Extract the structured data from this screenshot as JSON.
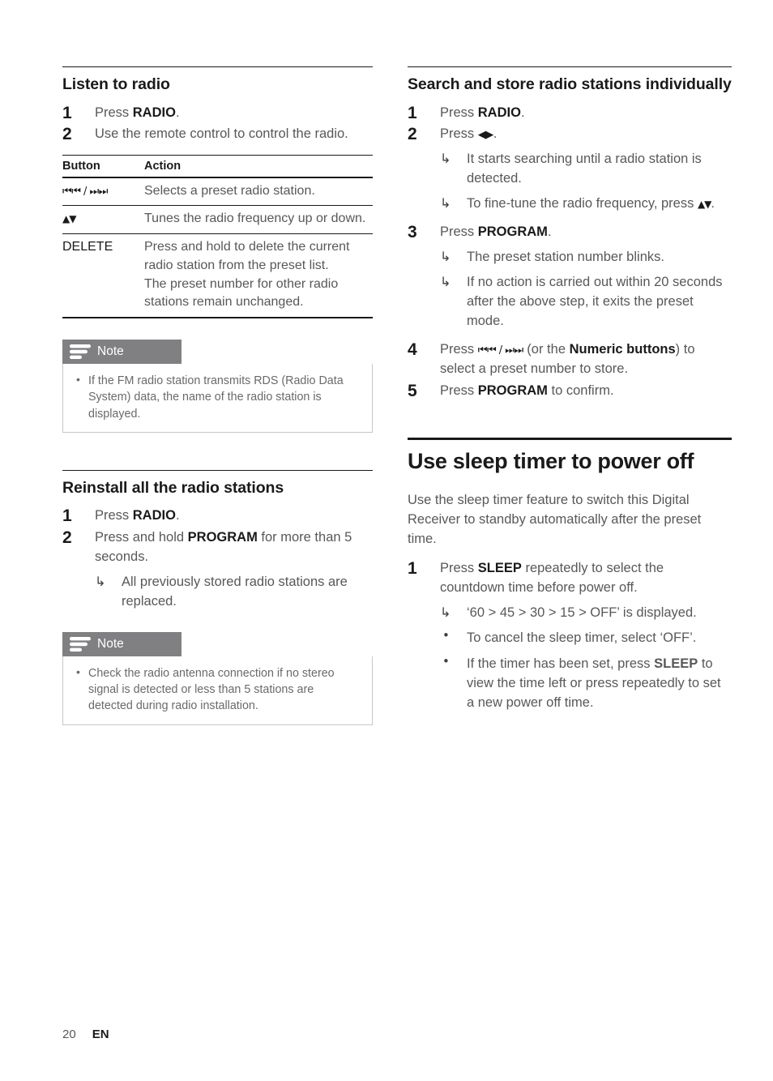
{
  "page": {
    "number": "20",
    "language": "EN"
  },
  "left_column": {
    "section1": {
      "heading": "Listen to radio",
      "steps": [
        {
          "num": "1",
          "text_before": "Press ",
          "bold": "RADIO",
          "text_after": "."
        },
        {
          "num": "2",
          "text_before": "Use the remote control to control the radio.",
          "bold": "",
          "text_after": ""
        }
      ],
      "table": {
        "headers": [
          "Button",
          "Action"
        ],
        "rows": [
          {
            "button_glyph": "⏮⏮ / ⏭⏭",
            "button_text": "",
            "action": "Selects a preset radio station."
          },
          {
            "button_glyph": "▲▼",
            "button_text": "",
            "action": "Tunes the radio frequency up or down."
          },
          {
            "button_glyph": "",
            "button_text": "DELETE",
            "action": "Press and hold to delete the current radio station from the preset list.\nThe preset number for other radio stations remain unchanged."
          }
        ]
      },
      "note": {
        "label": "Note",
        "items": [
          "If the FM radio station transmits RDS (Radio Data System) data, the name of the radio station is displayed."
        ]
      }
    },
    "section2": {
      "heading": "Reinstall all the radio stations",
      "steps": [
        {
          "num": "1",
          "text_before": "Press ",
          "bold": "RADIO",
          "text_after": "."
        },
        {
          "num": "2",
          "text_before": "Press and hold ",
          "bold": "PROGRAM",
          "text_after": " for more than 5 seconds.",
          "subs": [
            {
              "arrow": "↳",
              "text": "All previously stored radio stations are replaced."
            }
          ]
        }
      ],
      "note": {
        "label": "Note",
        "items": [
          "Check the radio antenna connection if no stereo signal is detected or less than 5 stations are detected during radio installation."
        ]
      }
    }
  },
  "right_column": {
    "section1": {
      "heading": "Search and store radio stations individually",
      "steps": [
        {
          "num": "1",
          "text_before": "Press ",
          "bold": "RADIO",
          "text_after": "."
        },
        {
          "num": "2",
          "text_before": "Press ",
          "glyph": "◀▶",
          "text_after": ".",
          "subs": [
            {
              "arrow": "↳",
              "text": "It starts searching until a radio station is detected."
            },
            {
              "arrow": "↳",
              "text_before": "To fine-tune the radio frequency, press ",
              "glyph": "▲▼",
              "text_after": "."
            }
          ]
        },
        {
          "num": "3",
          "text_before": "Press ",
          "bold": "PROGRAM",
          "text_after": ".",
          "subs": [
            {
              "arrow": "↳",
              "text": "The preset station number blinks."
            },
            {
              "arrow": "↳",
              "text": "If no action is carried out within 20 seconds after the above step, it exits the preset mode."
            }
          ]
        },
        {
          "num": "4",
          "text_before": "Press ",
          "glyph": "⏮⏮ / ⏭⏭",
          "text_mid": " (or the ",
          "bold": "Numeric buttons",
          "text_after": ") to select a preset number to store."
        },
        {
          "num": "5",
          "text_before": "Press ",
          "bold": "PROGRAM",
          "text_after": " to confirm."
        }
      ]
    },
    "section2": {
      "heading": "Use sleep timer to power off",
      "intro": "Use the sleep timer feature to switch this Digital Receiver to standby automatically after the preset time.",
      "steps": [
        {
          "num": "1",
          "text_before": "Press ",
          "bold": "SLEEP",
          "text_after": " repeatedly to select the countdown time before power off.",
          "subs": [
            {
              "arrow": "↳",
              "text": "‘60 > 45 > 30 > 15 > OFF’ is displayed."
            },
            {
              "arrow": "•",
              "text": "To cancel the sleep timer, select ‘OFF’."
            },
            {
              "arrow": "•",
              "text_before": "If the timer has been set, press ",
              "bold": "SLEEP",
              "text_after": " to view the time left or press repeatedly to set a new power off time."
            }
          ]
        }
      ]
    }
  },
  "colors": {
    "body_text": "#58585a",
    "strong_text": "#1a1a1a",
    "note_tab": "#808083",
    "note_border": "#c7c7c9"
  }
}
